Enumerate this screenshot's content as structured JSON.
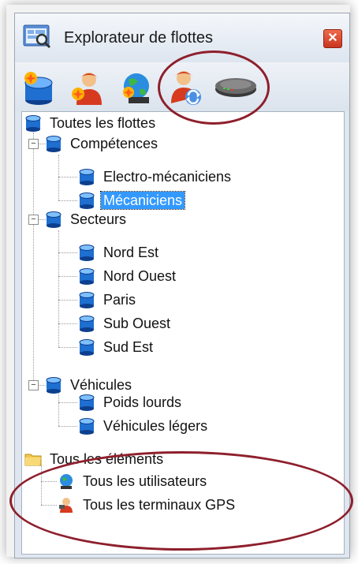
{
  "window": {
    "title": "Explorateur de flottes",
    "close_label": "✕"
  },
  "toolbar": {
    "buttons": [
      "fleet-add",
      "user-add",
      "globe-add",
      "user-sync",
      "gps-device"
    ]
  },
  "tree": {
    "root": "Toutes les flottes",
    "groups": [
      {
        "label": "Compétences",
        "expander": "−",
        "children": [
          "Electro-mécaniciens",
          "Mécaniciens"
        ]
      },
      {
        "label": "Secteurs",
        "expander": "−",
        "children": [
          "Nord Est",
          "Nord Ouest",
          "Paris",
          "Sub Ouest",
          "Sud Est"
        ]
      },
      {
        "label": "Véhicules",
        "expander": "−",
        "children": [
          "Poids lourds",
          "Véhicules légers"
        ]
      }
    ],
    "selected": "Mécaniciens",
    "elements_root": "Tous les éléments",
    "elements": [
      "Tous les utilisateurs",
      "Tous les terminaux GPS"
    ]
  },
  "colors": {
    "highlight": "#8e1f2c",
    "selection": "#3399ff"
  }
}
